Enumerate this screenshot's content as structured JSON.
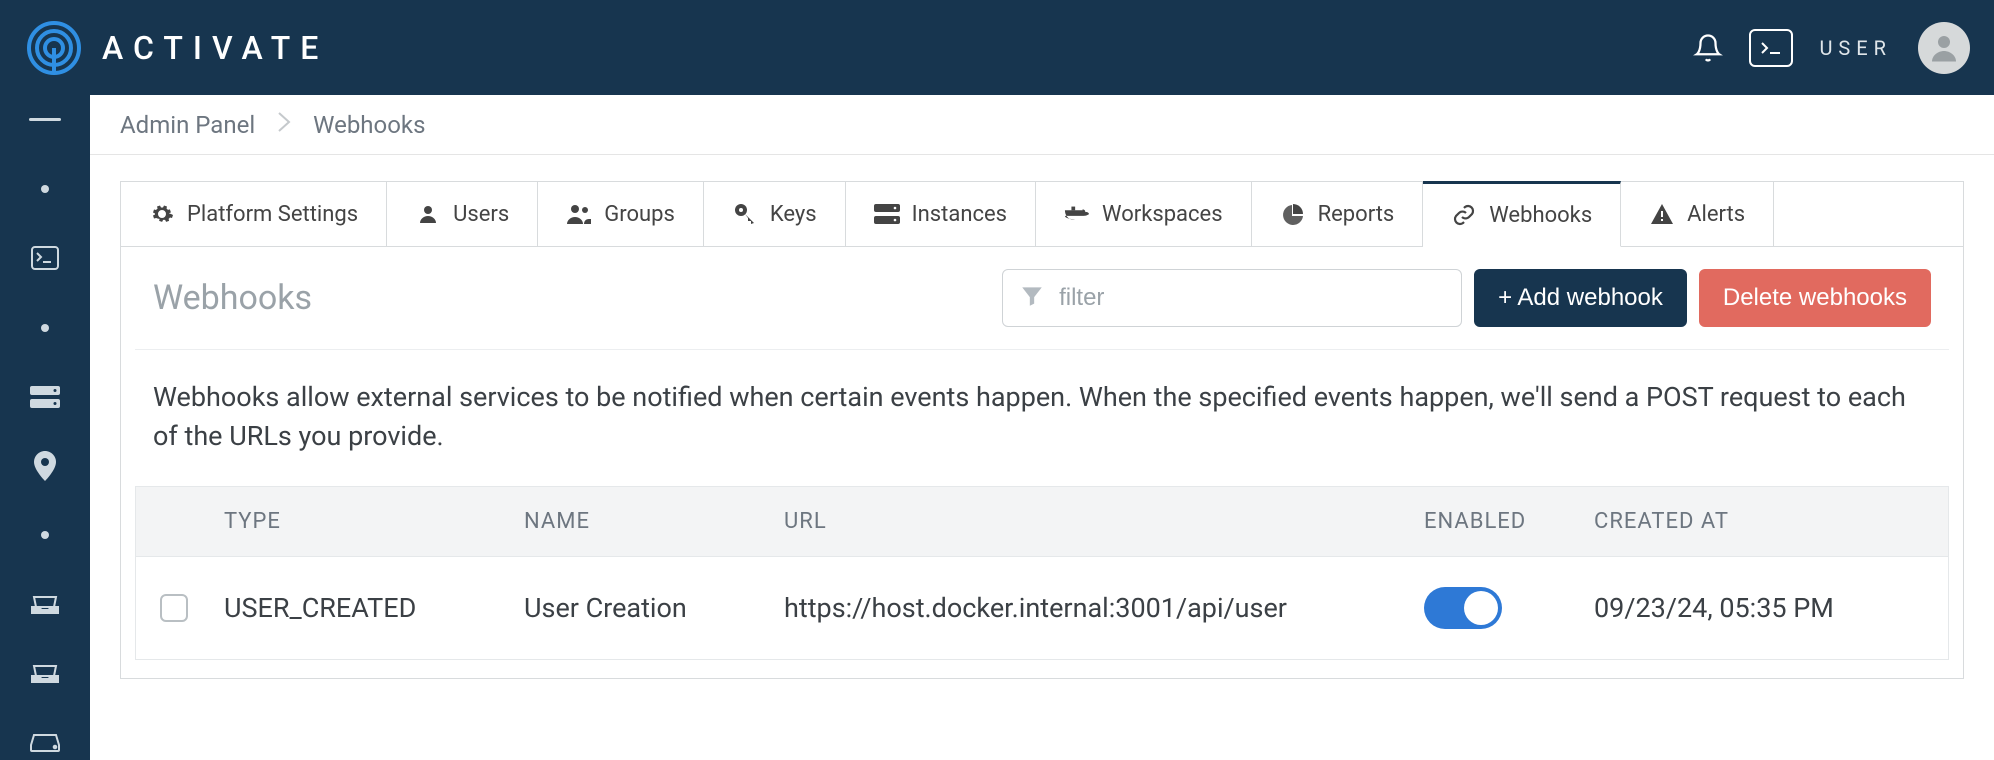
{
  "header": {
    "brand": "ACTIVATE",
    "user_label": "USER"
  },
  "breadcrumb": {
    "root": "Admin Panel",
    "current": "Webhooks"
  },
  "tabs": [
    {
      "label": "Platform Settings",
      "icon": "gears-icon"
    },
    {
      "label": "Users",
      "icon": "user-icon"
    },
    {
      "label": "Groups",
      "icon": "users-icon"
    },
    {
      "label": "Keys",
      "icon": "key-icon"
    },
    {
      "label": "Instances",
      "icon": "server-icon"
    },
    {
      "label": "Workspaces",
      "icon": "docker-icon"
    },
    {
      "label": "Reports",
      "icon": "piechart-icon"
    },
    {
      "label": "Webhooks",
      "icon": "link-icon",
      "active": true
    },
    {
      "label": "Alerts",
      "icon": "warning-icon"
    }
  ],
  "panel": {
    "title": "Webhooks",
    "filter_placeholder": "filter",
    "add_label": "+ Add webhook",
    "delete_label": "Delete webhooks",
    "description": "Webhooks allow external services to be notified when certain events happen. When the specified events happen, we'll send a POST request to each of the URLs you provide."
  },
  "table": {
    "headers": {
      "type": "TYPE",
      "name": "NAME",
      "url": "URL",
      "enabled": "ENABLED",
      "created": "CREATED AT"
    },
    "rows": [
      {
        "type": "USER_CREATED",
        "name": "User Creation",
        "url": "https://host.docker.internal:3001/api/user",
        "enabled": true,
        "created": "09/23/24, 05:35 PM"
      }
    ]
  }
}
